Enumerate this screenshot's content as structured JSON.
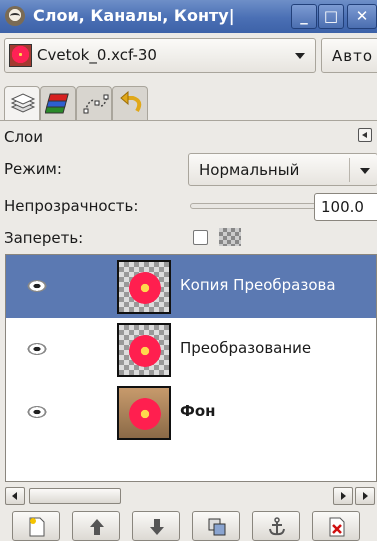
{
  "window": {
    "title": "Слои, Каналы, Конту|",
    "min_label": "_",
    "max_label": "□",
    "close_label": "✕"
  },
  "image_selector": {
    "name": "Cvetok_0.xcf-30",
    "auto_label": "Авто"
  },
  "tabs": [
    {
      "icon": "layers-icon"
    },
    {
      "icon": "channels-icon"
    },
    {
      "icon": "paths-icon"
    },
    {
      "icon": "undo-history-icon"
    }
  ],
  "layers_panel": {
    "title": "Слои",
    "mode_label": "Режим:",
    "mode_value": "Нормальный",
    "opacity_label": "Непрозрачность:",
    "opacity_value": "100.0",
    "lock_label": "Запереть:"
  },
  "layers": [
    {
      "name": "Копия Преобразова",
      "selected": true,
      "visible": true
    },
    {
      "name": "Преобразование",
      "selected": false,
      "visible": true
    },
    {
      "name": "Фон",
      "selected": false,
      "visible": true
    }
  ],
  "bottom_buttons": [
    {
      "icon": "new-layer-icon"
    },
    {
      "icon": "raise-layer-icon"
    },
    {
      "icon": "lower-layer-icon"
    },
    {
      "icon": "duplicate-layer-icon"
    },
    {
      "icon": "anchor-layer-icon"
    },
    {
      "icon": "delete-layer-icon"
    }
  ],
  "colors": {
    "titlebar": "#4a6fb4",
    "selection": "#5b79b2"
  }
}
